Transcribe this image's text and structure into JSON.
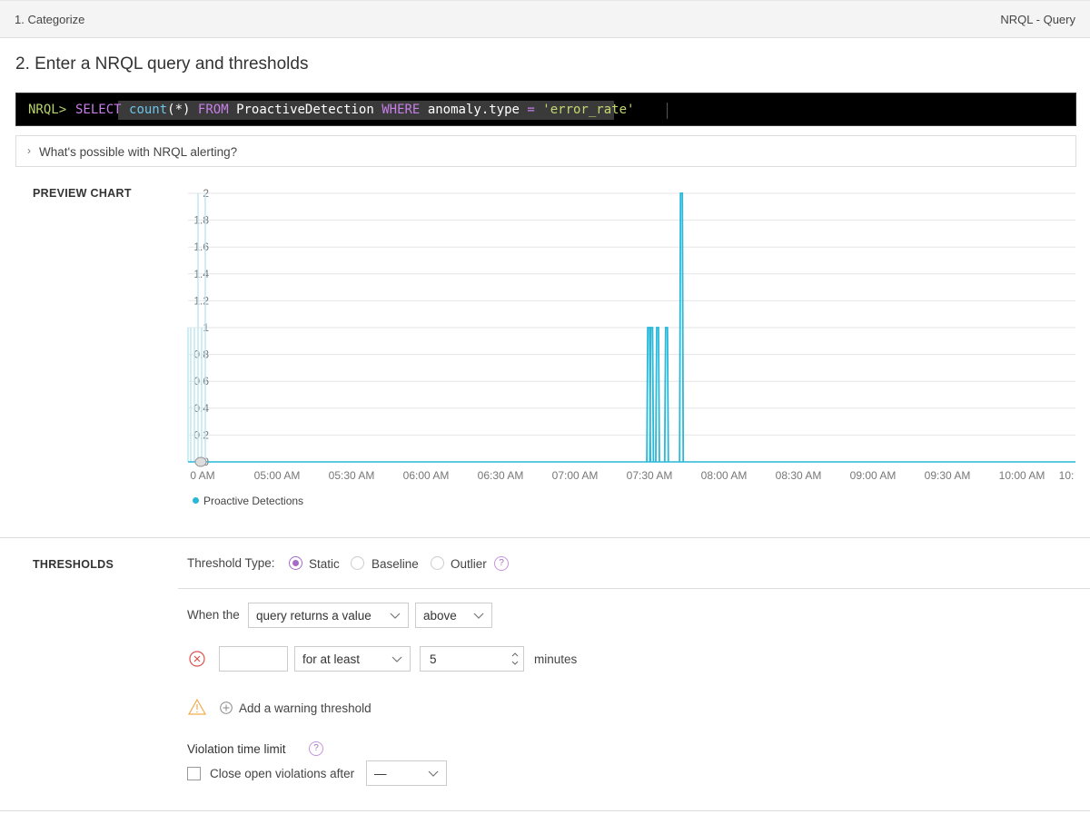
{
  "topbar": {
    "left_label": "1. Categorize",
    "right_label": "NRQL - Query"
  },
  "section_title": "2. Enter a NRQL query and thresholds",
  "nrql": {
    "prompt": "NRQL>",
    "select_kw": "SELECT",
    "count_fn": "count",
    "count_arg": "(*)",
    "from_kw": "FROM",
    "table": "ProactiveDetection",
    "where_kw": "WHERE",
    "field": "anomaly.type",
    "op": "=",
    "value": "'error_rate'"
  },
  "help_link": "What's possible with NRQL alerting?",
  "preview_chart_label": "PREVIEW CHART",
  "chart_data": {
    "type": "line",
    "y_ticks": [
      "0",
      "0.2",
      "0.4",
      "0.6",
      "0.8",
      "1",
      "1.2",
      "1.4",
      "1.6",
      "1.8",
      "2"
    ],
    "ylim": [
      0,
      2
    ],
    "x_ticks": [
      "0 AM",
      "05:00 AM",
      "05:30 AM",
      "06:00 AM",
      "06:30 AM",
      "07:00 AM",
      "07:30 AM",
      "08:00 AM",
      "08:30 AM",
      "09:00 AM",
      "09:30 AM",
      "10:00 AM",
      "10:"
    ],
    "series": [
      {
        "name": "Proactive Detections",
        "color": "#29b8d8",
        "spikes": [
          {
            "t": 7.58,
            "value": 1
          },
          {
            "t": 7.6,
            "value": 1
          },
          {
            "t": 7.64,
            "value": 1
          },
          {
            "t": 7.7,
            "value": 1
          },
          {
            "t": 7.8,
            "value": 2
          }
        ]
      }
    ]
  },
  "legend": {
    "label": "Proactive Detections"
  },
  "thresholds_label": "THRESHOLDS",
  "threshold_type": {
    "label": "Threshold Type:",
    "options": [
      "Static",
      "Baseline",
      "Outlier"
    ],
    "selected": "Static",
    "help": "?"
  },
  "condition": {
    "when_label": "When the",
    "query_select": "query returns a value",
    "comparison_select": "above",
    "duration_select": "for at least",
    "minutes_value": "5",
    "minutes_label": "minutes",
    "add_warning": "Add a warning threshold"
  },
  "violation": {
    "label": "Violation time limit",
    "help": "?",
    "checkbox_label": "Close open violations after",
    "select_value": "—"
  },
  "colors": {
    "accent": "#a56bc7",
    "series": "#29b8d8",
    "critical": "#d9534f",
    "warning": "#f0ad4e"
  }
}
